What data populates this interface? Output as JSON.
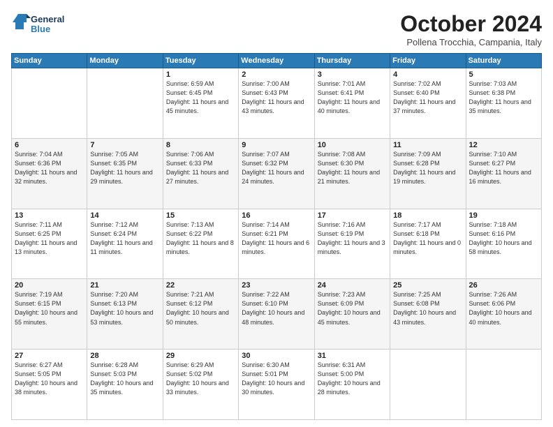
{
  "header": {
    "logo_line1": "General",
    "logo_line2": "Blue",
    "month": "October 2024",
    "location": "Pollena Trocchia, Campania, Italy"
  },
  "weekdays": [
    "Sunday",
    "Monday",
    "Tuesday",
    "Wednesday",
    "Thursday",
    "Friday",
    "Saturday"
  ],
  "weeks": [
    [
      {
        "day": "",
        "info": ""
      },
      {
        "day": "",
        "info": ""
      },
      {
        "day": "1",
        "info": "Sunrise: 6:59 AM\nSunset: 6:45 PM\nDaylight: 11 hours and 45 minutes."
      },
      {
        "day": "2",
        "info": "Sunrise: 7:00 AM\nSunset: 6:43 PM\nDaylight: 11 hours and 43 minutes."
      },
      {
        "day": "3",
        "info": "Sunrise: 7:01 AM\nSunset: 6:41 PM\nDaylight: 11 hours and 40 minutes."
      },
      {
        "day": "4",
        "info": "Sunrise: 7:02 AM\nSunset: 6:40 PM\nDaylight: 11 hours and 37 minutes."
      },
      {
        "day": "5",
        "info": "Sunrise: 7:03 AM\nSunset: 6:38 PM\nDaylight: 11 hours and 35 minutes."
      }
    ],
    [
      {
        "day": "6",
        "info": "Sunrise: 7:04 AM\nSunset: 6:36 PM\nDaylight: 11 hours and 32 minutes."
      },
      {
        "day": "7",
        "info": "Sunrise: 7:05 AM\nSunset: 6:35 PM\nDaylight: 11 hours and 29 minutes."
      },
      {
        "day": "8",
        "info": "Sunrise: 7:06 AM\nSunset: 6:33 PM\nDaylight: 11 hours and 27 minutes."
      },
      {
        "day": "9",
        "info": "Sunrise: 7:07 AM\nSunset: 6:32 PM\nDaylight: 11 hours and 24 minutes."
      },
      {
        "day": "10",
        "info": "Sunrise: 7:08 AM\nSunset: 6:30 PM\nDaylight: 11 hours and 21 minutes."
      },
      {
        "day": "11",
        "info": "Sunrise: 7:09 AM\nSunset: 6:28 PM\nDaylight: 11 hours and 19 minutes."
      },
      {
        "day": "12",
        "info": "Sunrise: 7:10 AM\nSunset: 6:27 PM\nDaylight: 11 hours and 16 minutes."
      }
    ],
    [
      {
        "day": "13",
        "info": "Sunrise: 7:11 AM\nSunset: 6:25 PM\nDaylight: 11 hours and 13 minutes."
      },
      {
        "day": "14",
        "info": "Sunrise: 7:12 AM\nSunset: 6:24 PM\nDaylight: 11 hours and 11 minutes."
      },
      {
        "day": "15",
        "info": "Sunrise: 7:13 AM\nSunset: 6:22 PM\nDaylight: 11 hours and 8 minutes."
      },
      {
        "day": "16",
        "info": "Sunrise: 7:14 AM\nSunset: 6:21 PM\nDaylight: 11 hours and 6 minutes."
      },
      {
        "day": "17",
        "info": "Sunrise: 7:16 AM\nSunset: 6:19 PM\nDaylight: 11 hours and 3 minutes."
      },
      {
        "day": "18",
        "info": "Sunrise: 7:17 AM\nSunset: 6:18 PM\nDaylight: 11 hours and 0 minutes."
      },
      {
        "day": "19",
        "info": "Sunrise: 7:18 AM\nSunset: 6:16 PM\nDaylight: 10 hours and 58 minutes."
      }
    ],
    [
      {
        "day": "20",
        "info": "Sunrise: 7:19 AM\nSunset: 6:15 PM\nDaylight: 10 hours and 55 minutes."
      },
      {
        "day": "21",
        "info": "Sunrise: 7:20 AM\nSunset: 6:13 PM\nDaylight: 10 hours and 53 minutes."
      },
      {
        "day": "22",
        "info": "Sunrise: 7:21 AM\nSunset: 6:12 PM\nDaylight: 10 hours and 50 minutes."
      },
      {
        "day": "23",
        "info": "Sunrise: 7:22 AM\nSunset: 6:10 PM\nDaylight: 10 hours and 48 minutes."
      },
      {
        "day": "24",
        "info": "Sunrise: 7:23 AM\nSunset: 6:09 PM\nDaylight: 10 hours and 45 minutes."
      },
      {
        "day": "25",
        "info": "Sunrise: 7:25 AM\nSunset: 6:08 PM\nDaylight: 10 hours and 43 minutes."
      },
      {
        "day": "26",
        "info": "Sunrise: 7:26 AM\nSunset: 6:06 PM\nDaylight: 10 hours and 40 minutes."
      }
    ],
    [
      {
        "day": "27",
        "info": "Sunrise: 6:27 AM\nSunset: 5:05 PM\nDaylight: 10 hours and 38 minutes."
      },
      {
        "day": "28",
        "info": "Sunrise: 6:28 AM\nSunset: 5:03 PM\nDaylight: 10 hours and 35 minutes."
      },
      {
        "day": "29",
        "info": "Sunrise: 6:29 AM\nSunset: 5:02 PM\nDaylight: 10 hours and 33 minutes."
      },
      {
        "day": "30",
        "info": "Sunrise: 6:30 AM\nSunset: 5:01 PM\nDaylight: 10 hours and 30 minutes."
      },
      {
        "day": "31",
        "info": "Sunrise: 6:31 AM\nSunset: 5:00 PM\nDaylight: 10 hours and 28 minutes."
      },
      {
        "day": "",
        "info": ""
      },
      {
        "day": "",
        "info": ""
      }
    ]
  ]
}
